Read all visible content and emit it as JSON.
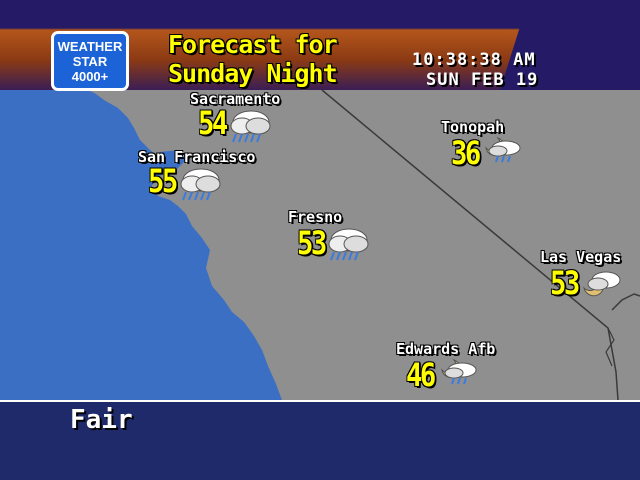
{
  "colors": {
    "ocean": "#3a6fc4",
    "land": "#8f8f8f",
    "border": "#3a3a3a",
    "header_top": "#241a66",
    "header_orange": "#b4561b",
    "temp_text": "#ffff00",
    "city_text": "#ffffff",
    "bottom_bar": "#1e2a6a"
  },
  "logo": {
    "line1": "WEATHER",
    "line2": "STAR",
    "line3": "4000+"
  },
  "header": {
    "title_line1": "Forecast for",
    "title_line2": "Sunday Night",
    "time": "10:38:38 AM",
    "date": "SUN FEB 19"
  },
  "cities": [
    {
      "name": "Sacramento",
      "temp": "54",
      "icon": "rain-cloud-icon"
    },
    {
      "name": "San Francisco",
      "temp": "55",
      "icon": "rain-cloud-icon"
    },
    {
      "name": "Fresno",
      "temp": "53",
      "icon": "rain-cloud-icon"
    },
    {
      "name": "Tonopah",
      "temp": "36",
      "icon": "moon-cloud-rain-icon"
    },
    {
      "name": "Las Vegas",
      "temp": "53",
      "icon": "moon-cloud-icon"
    },
    {
      "name": "Edwards Afb",
      "temp": "46",
      "icon": "moon-cloud-rain-icon"
    }
  ],
  "footer": {
    "conditions": "Fair"
  }
}
